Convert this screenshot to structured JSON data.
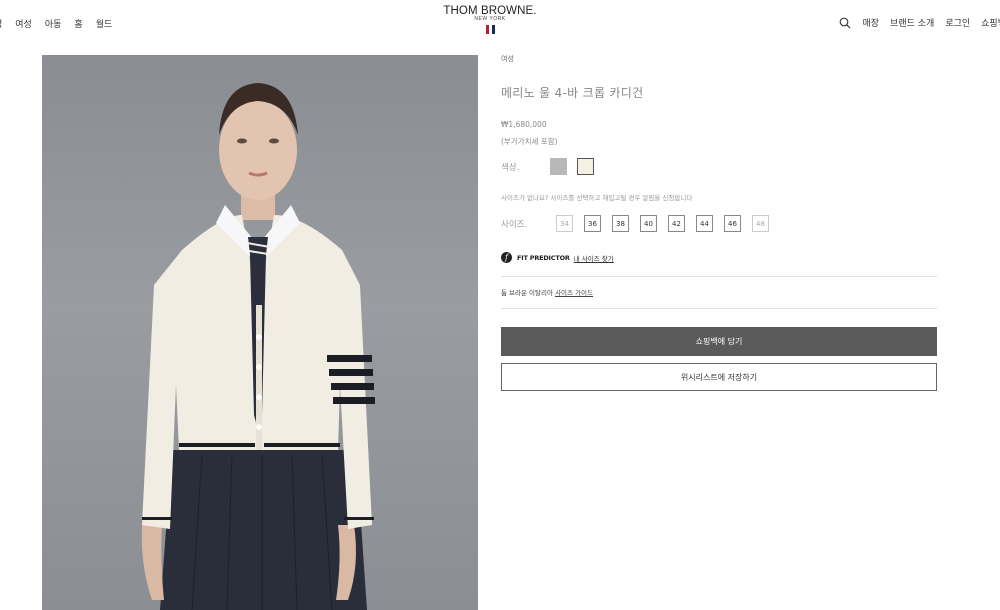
{
  "header": {
    "nav_left": [
      "성",
      "여성",
      "아동",
      "홈",
      "월드"
    ],
    "logo": {
      "brand": "THOM BROWNE.",
      "city": "NEW YORK",
      "flag_colors": [
        "#b51f2e",
        "#1a2a5c"
      ]
    },
    "nav_right": [
      "매장",
      "브랜드 소개",
      "로그인",
      "쇼핑백"
    ]
  },
  "product": {
    "breadcrumb": "여성",
    "title": "메리노 울 4-바 크롭 카디건",
    "price": "₩1,680,000",
    "vat_note": "(부가가치세 포함)",
    "color_label": "색상.",
    "colors": [
      "#b8b8b8",
      "#f4f0e4"
    ],
    "size_note": "사이즈가 없나요? 사이즈를 선택하고 재입고될 경우 알림을 신청합니다",
    "size_label": "사이즈.",
    "sizes": [
      "34",
      "36",
      "38",
      "40",
      "42",
      "44",
      "46",
      "48"
    ],
    "fit_predictor": {
      "name": "FIT PREDICTOR",
      "link": "내 사이즈 찾기"
    },
    "size_guide": {
      "text": "톰 브라운 이탈리아",
      "link": "사이즈 가이드"
    },
    "add_to_bag": "쇼핑백에 담기",
    "wishlist": "위시리스트에 저장하기"
  }
}
